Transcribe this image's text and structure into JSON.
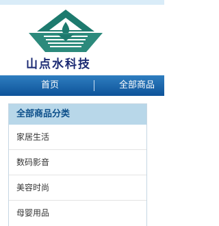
{
  "header": {
    "logo_text": "山点水科技"
  },
  "nav": {
    "items": [
      "首页",
      "全部商品"
    ]
  },
  "categories": {
    "title": "全部商品分类",
    "items": [
      "家居生活",
      "数码影音",
      "美容时尚",
      "母婴用品"
    ]
  },
  "colors": {
    "nav_bar": "#1a64a8",
    "panel_header": "#b8d7e9",
    "logo_teal": "#1d7a6e",
    "logo_text": "#1b2a73"
  }
}
